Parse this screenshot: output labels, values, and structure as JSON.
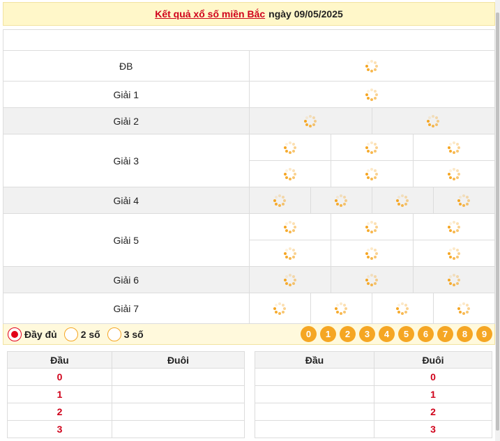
{
  "header": {
    "title_link": "Kết quả xổ số miền Bắc",
    "date_text": "ngày 09/05/2025"
  },
  "prizes": [
    {
      "label": "ĐB",
      "rows": [
        1
      ]
    },
    {
      "label": "Giải 1",
      "rows": [
        1
      ]
    },
    {
      "label": "Giải 2",
      "rows": [
        2
      ]
    },
    {
      "label": "Giải 3",
      "rows": [
        3,
        3
      ]
    },
    {
      "label": "Giải 4",
      "rows": [
        4
      ]
    },
    {
      "label": "Giải 5",
      "rows": [
        3,
        3
      ]
    },
    {
      "label": "Giải 6",
      "rows": [
        3
      ]
    },
    {
      "label": "Giải 7",
      "rows": [
        4
      ]
    }
  ],
  "display_options": [
    {
      "label": "Đầy đủ",
      "checked": true
    },
    {
      "label": "2 số",
      "checked": false
    },
    {
      "label": "3 số",
      "checked": false
    }
  ],
  "digit_buttons": [
    "0",
    "1",
    "2",
    "3",
    "4",
    "5",
    "6",
    "7",
    "8",
    "9"
  ],
  "dau_duoi_left": {
    "headers": [
      "Đầu",
      "Đuôi"
    ],
    "rows": [
      "0",
      "1",
      "2",
      "3"
    ]
  },
  "dau_duoi_right": {
    "headers": [
      "Đầu",
      "Đuôi"
    ],
    "rows": [
      "0",
      "1",
      "2",
      "3"
    ]
  },
  "colors": {
    "accent_red": "#d0021b",
    "spinner_orange": "#f5a623",
    "header_bg": "#fff7c9"
  },
  "icons": {
    "loading": "loading-spinner-icon"
  }
}
